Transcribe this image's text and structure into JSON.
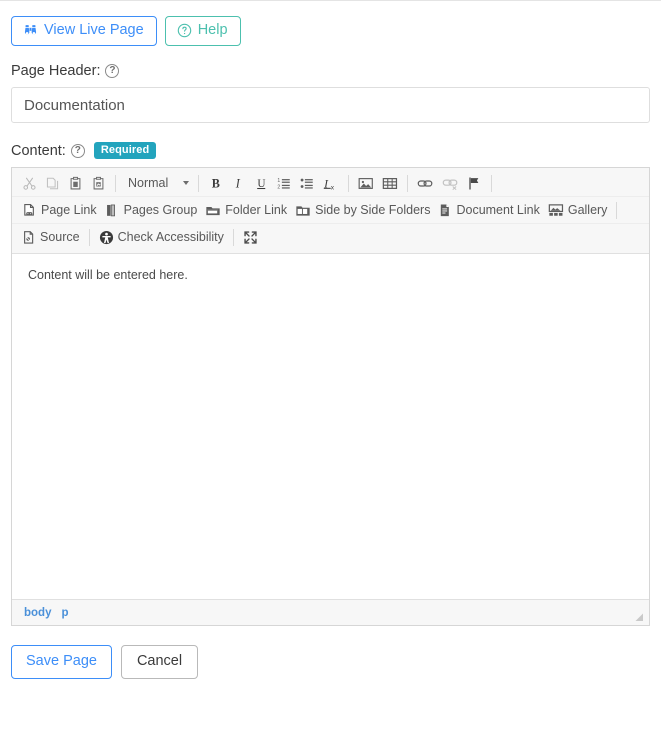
{
  "top_buttons": [
    {
      "label": "View Live Page",
      "icon": "binoculars-icon",
      "color": "#3d8ef8"
    },
    {
      "label": "Help",
      "icon": "question-circle-icon",
      "color": "#4cc0ae"
    }
  ],
  "page_header_field": {
    "label": "Page Header:",
    "help_icon": "question-circle-icon",
    "value": "Documentation",
    "placeholder": ""
  },
  "content_field": {
    "label": "Content:",
    "help_icon": "question-circle-icon",
    "required_badge": "Required"
  },
  "editor": {
    "toolbar_row1": [
      {
        "type": "icon",
        "name": "cut-icon",
        "title": "Cut",
        "disabled": true
      },
      {
        "type": "icon",
        "name": "copy-icon",
        "title": "Copy",
        "disabled": true
      },
      {
        "type": "icon",
        "name": "paste-icon",
        "title": "Paste",
        "disabled": false
      },
      {
        "type": "icon",
        "name": "paste-from-word-icon",
        "title": "Paste from Word",
        "disabled": false
      },
      {
        "type": "separator"
      },
      {
        "type": "combo",
        "name": "paragraph-format-select",
        "value": "Normal"
      },
      {
        "type": "separator"
      },
      {
        "type": "icon",
        "name": "bold-icon",
        "title": "Bold",
        "disabled": false
      },
      {
        "type": "icon",
        "name": "italic-icon",
        "title": "Italic",
        "disabled": false
      },
      {
        "type": "icon",
        "name": "underline-icon",
        "title": "Underline",
        "disabled": false
      },
      {
        "type": "icon",
        "name": "numbered-list-icon",
        "title": "Insert/Remove Numbered List",
        "disabled": false
      },
      {
        "type": "icon",
        "name": "bulleted-list-icon",
        "title": "Insert/Remove Bulleted List",
        "disabled": false
      },
      {
        "type": "icon",
        "name": "remove-format-icon",
        "title": "Remove Format",
        "disabled": false
      },
      {
        "type": "separator"
      },
      {
        "type": "icon",
        "name": "image-icon",
        "title": "Image",
        "disabled": false
      },
      {
        "type": "icon",
        "name": "table-icon",
        "title": "Table",
        "disabled": false
      },
      {
        "type": "separator"
      },
      {
        "type": "icon",
        "name": "link-icon",
        "title": "Link",
        "disabled": false
      },
      {
        "type": "icon",
        "name": "unlink-icon",
        "title": "Unlink",
        "disabled": true
      },
      {
        "type": "icon",
        "name": "anchor-flag-icon",
        "title": "Anchor",
        "disabled": false
      },
      {
        "type": "separator"
      }
    ],
    "toolbar_row2": [
      {
        "label": "Page Link",
        "icon": "page-link-icon"
      },
      {
        "label": "Pages Group",
        "icon": "pages-group-icon"
      },
      {
        "label": "Folder Link",
        "icon": "folder-link-icon"
      },
      {
        "label": "Side by Side Folders",
        "icon": "side-by-side-folders-icon"
      },
      {
        "label": "Document Link",
        "icon": "document-link-icon"
      },
      {
        "label": "Gallery",
        "icon": "gallery-icon"
      }
    ],
    "toolbar_row3": [
      {
        "label": "Source",
        "icon": "source-icon"
      },
      {
        "label": "Check Accessibility",
        "icon": "accessibility-icon"
      },
      {
        "label": "",
        "icon": "maximize-icon"
      }
    ],
    "body_text": "Content will be entered here.",
    "elements_path": [
      "body",
      "p"
    ]
  },
  "footer_buttons": {
    "save_label": "Save Page",
    "cancel_label": "Cancel"
  },
  "colors": {
    "primary_blue": "#3d8ef8",
    "teal": "#4cc0ae",
    "badge_teal": "#23a4bd",
    "path_blue": "#4a90d9"
  }
}
